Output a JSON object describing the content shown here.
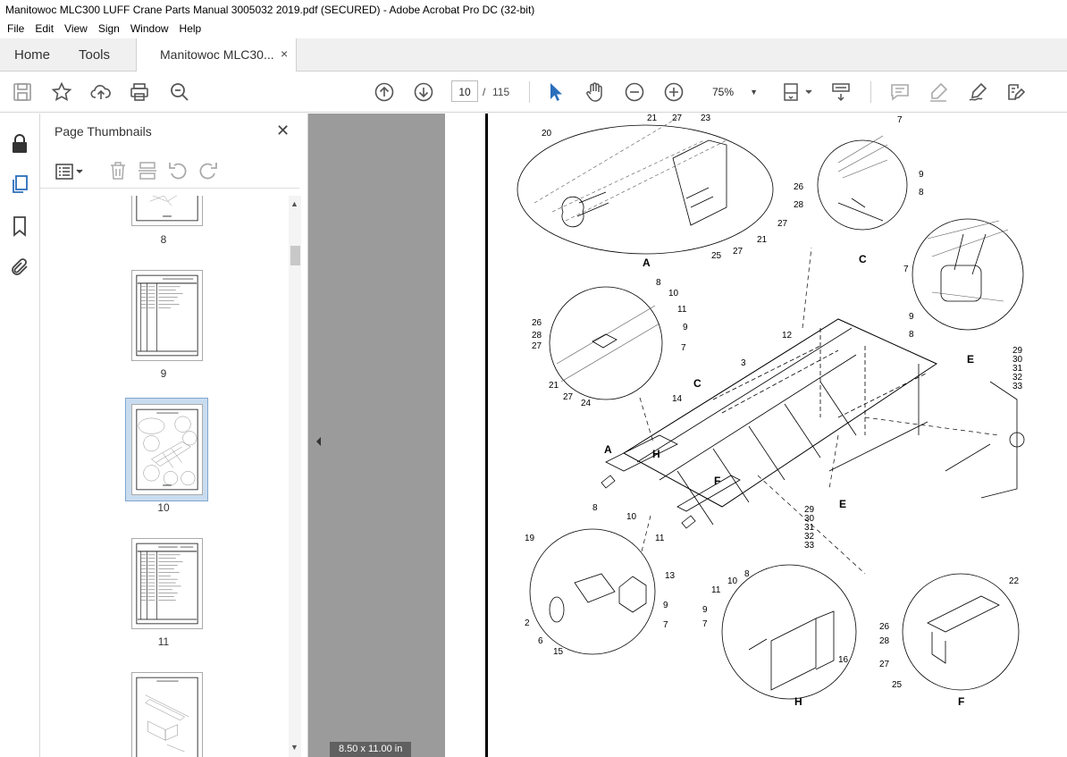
{
  "window": {
    "title": "Manitowoc MLC300 LUFF Crane Parts Manual 3005032 2019.pdf (SECURED) - Adobe Acrobat Pro DC (32-bit)"
  },
  "menu": [
    "File",
    "Edit",
    "View",
    "Sign",
    "Window",
    "Help"
  ],
  "tabs": {
    "home": "Home",
    "tools": "Tools",
    "document": "Manitowoc MLC30...",
    "close": "×"
  },
  "toolbar": {
    "current_page": "10",
    "separator": "/",
    "total_pages": "115",
    "zoom": "75%"
  },
  "thumbnail_panel": {
    "title": "Page Thumbnails",
    "close": "✕",
    "pages": [
      {
        "label": "8"
      },
      {
        "label": "9"
      },
      {
        "label": "10",
        "selected": true
      },
      {
        "label": "11"
      }
    ]
  },
  "status": {
    "page_size": "8.50 x 11.00 in"
  },
  "drawing": {
    "details": [
      "A",
      "C",
      "E",
      "H",
      "F"
    ],
    "callouts": [
      "20",
      "21",
      "27",
      "23",
      "26",
      "28",
      "27",
      "21",
      "25",
      "27",
      "7",
      "9",
      "8",
      "7",
      "9",
      "8",
      "8",
      "10",
      "11",
      "9",
      "7",
      "26",
      "28",
      "27",
      "21",
      "27",
      "24",
      "12",
      "3",
      "14",
      "29",
      "30",
      "31",
      "32",
      "33",
      "29",
      "30",
      "31",
      "32",
      "33",
      "8",
      "10",
      "11",
      "19",
      "13",
      "9",
      "7",
      "2",
      "6",
      "15",
      "8",
      "10",
      "11",
      "9",
      "7",
      "16",
      "22",
      "26",
      "28",
      "27",
      "25"
    ]
  },
  "colors": {
    "accent": "#2a6ebb",
    "gutter": "#9b9b9b",
    "tab_bg": "#f0f0f0"
  }
}
